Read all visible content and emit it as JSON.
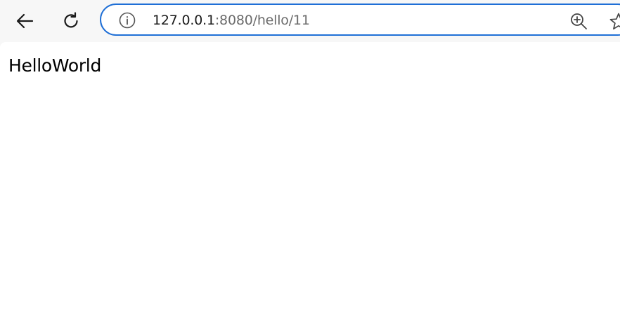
{
  "browser": {
    "back_icon": "arrow-left-icon",
    "reload_icon": "reload-icon",
    "address": {
      "host": "127.0.0.1",
      "rest": ":8080/hello/11",
      "info_icon": "info-icon",
      "zoom_icon": "zoom-in-icon",
      "favorite_icon": "star-icon",
      "focus_color": "#1f6fd6"
    }
  },
  "page": {
    "body_text": "HelloWorld"
  }
}
